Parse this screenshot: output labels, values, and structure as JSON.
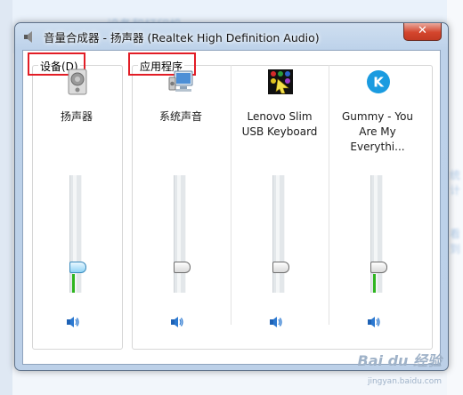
{
  "window": {
    "title": "音量合成器 - 扬声器 (Realtek High Definition Audio)",
    "close_label": "✕"
  },
  "groups": {
    "devices_label": "设备(D)",
    "apps_label": "应用程序"
  },
  "channels": [
    {
      "name": "扬声器",
      "icon": "speaker-device-icon",
      "volume": 0.22,
      "peak": 0.16
    },
    {
      "name": "系统声音",
      "icon": "system-sounds-icon",
      "volume": 0.22,
      "peak": 0.0
    },
    {
      "name": "Lenovo Slim\nUSB Keyboard",
      "icon": "lenovo-keyboard-app-icon",
      "volume": 0.22,
      "peak": 0.0
    },
    {
      "name": "Gummy - You\nAre My Everythi...",
      "icon": "kugou-k-icon",
      "volume": 0.22,
      "peak": 0.16
    }
  ],
  "background": {
    "top_text": "设备和打印机",
    "right_text_1": "统计",
    "right_text_2": "看到"
  },
  "watermark": {
    "text": "Bai du 经验",
    "url": "jingyan.baidu.com"
  },
  "colors": {
    "accent_red": "#e21d26",
    "peak_green": "#2eb51f",
    "close_red": "#d4452d"
  }
}
